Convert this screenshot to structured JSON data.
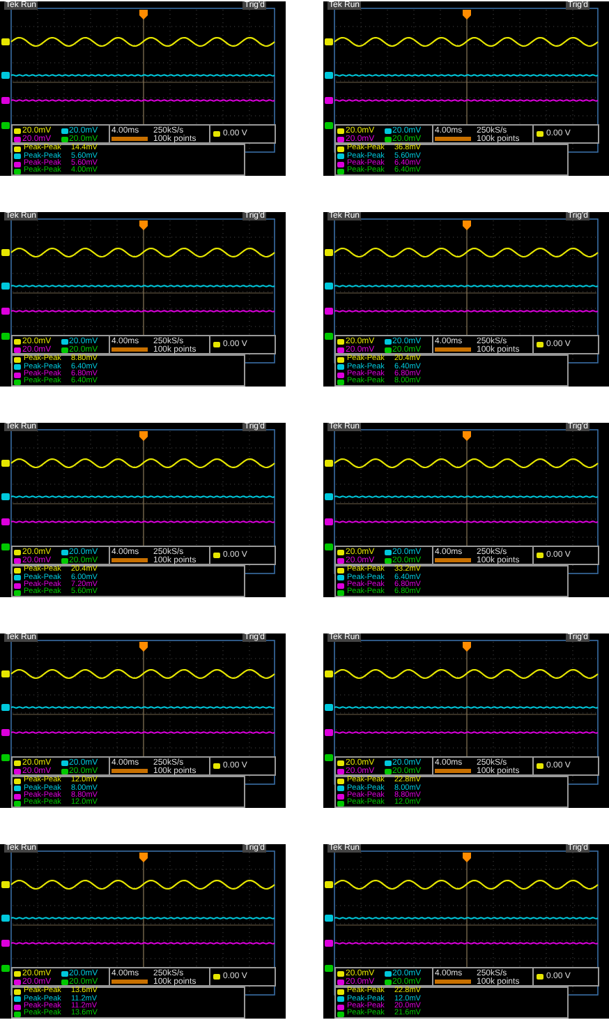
{
  "panels": [
    {
      "status": "Tek Run",
      "trigger_state": "Trig'd",
      "scales": [
        {
          "value": "20.0mV",
          "color": "#e6e600"
        },
        {
          "value": "20.0mV",
          "color": "#00c8dc"
        },
        {
          "value": "20.0mV",
          "color": "#dc00dc"
        },
        {
          "value": "20.0mV",
          "color": "#00c800"
        }
      ],
      "timebase": "4.00ms",
      "sample_rate": "250kS/s",
      "record": "100k points",
      "trigger_level": "0.00 V",
      "measurements": [
        {
          "label": "Peak-Peak",
          "value": "14.4mV"
        },
        {
          "label": "Peak-Peak",
          "value": "5.60mV"
        },
        {
          "label": "Peak-Peak",
          "value": "5.60mV"
        },
        {
          "label": "Peak-Peak",
          "value": "4.00mV"
        }
      ]
    },
    {
      "status": "Tek Run",
      "trigger_state": "Trig'd",
      "scales": [
        {
          "value": "20.0mV",
          "color": "#e6e600"
        },
        {
          "value": "20.0mV",
          "color": "#00c8dc"
        },
        {
          "value": "20.0mV",
          "color": "#dc00dc"
        },
        {
          "value": "20.0mV",
          "color": "#00c800"
        }
      ],
      "timebase": "4.00ms",
      "sample_rate": "250kS/s",
      "record": "100k points",
      "trigger_level": "0.00 V",
      "measurements": [
        {
          "label": "Peak-Peak",
          "value": "36.8mV"
        },
        {
          "label": "Peak-Peak",
          "value": "5.60mV"
        },
        {
          "label": "Peak-Peak",
          "value": "6.40mV"
        },
        {
          "label": "Peak-Peak",
          "value": "6.40mV"
        }
      ]
    },
    {
      "status": "Tek Run",
      "trigger_state": "Trig'd",
      "scales": [
        {
          "value": "20.0mV",
          "color": "#e6e600"
        },
        {
          "value": "20.0mV",
          "color": "#00c8dc"
        },
        {
          "value": "20.0mV",
          "color": "#dc00dc"
        },
        {
          "value": "20.0mV",
          "color": "#00c800"
        }
      ],
      "timebase": "4.00ms",
      "sample_rate": "250kS/s",
      "record": "100k points",
      "trigger_level": "0.00 V",
      "measurements": [
        {
          "label": "Peak-Peak",
          "value": "8.80mV"
        },
        {
          "label": "Peak-Peak",
          "value": "6.40mV"
        },
        {
          "label": "Peak-Peak",
          "value": "6.80mV"
        },
        {
          "label": "Peak-Peak",
          "value": "6.40mV"
        }
      ]
    },
    {
      "status": "Tek Run",
      "trigger_state": "Trig'd",
      "scales": [
        {
          "value": "20.0mV",
          "color": "#e6e600"
        },
        {
          "value": "20.0mV",
          "color": "#00c8dc"
        },
        {
          "value": "20.0mV",
          "color": "#dc00dc"
        },
        {
          "value": "20.0mV",
          "color": "#00c800"
        }
      ],
      "timebase": "4.00ms",
      "sample_rate": "250kS/s",
      "record": "100k points",
      "trigger_level": "0.00 V",
      "measurements": [
        {
          "label": "Peak-Peak",
          "value": "20.4mV"
        },
        {
          "label": "Peak-Peak",
          "value": "6.40mV"
        },
        {
          "label": "Peak-Peak",
          "value": "6.80mV"
        },
        {
          "label": "Peak-Peak",
          "value": "8.00mV"
        }
      ]
    },
    {
      "status": "Tek Run",
      "trigger_state": "Trig'd",
      "scales": [
        {
          "value": "20.0mV",
          "color": "#e6e600"
        },
        {
          "value": "20.0mV",
          "color": "#00c8dc"
        },
        {
          "value": "20.0mV",
          "color": "#dc00dc"
        },
        {
          "value": "20.0mV",
          "color": "#00c800"
        }
      ],
      "timebase": "4.00ms",
      "sample_rate": "250kS/s",
      "record": "100k points",
      "trigger_level": "0.00 V",
      "measurements": [
        {
          "label": "Peak-Peak",
          "value": "20.4mV"
        },
        {
          "label": "Peak-Peak",
          "value": "6.00mV"
        },
        {
          "label": "Peak-Peak",
          "value": "7.20mV"
        },
        {
          "label": "Peak-Peak",
          "value": "5.60mV"
        }
      ]
    },
    {
      "status": "Tek Run",
      "trigger_state": "Trig'd",
      "scales": [
        {
          "value": "20.0mV",
          "color": "#e6e600"
        },
        {
          "value": "20.0mV",
          "color": "#00c8dc"
        },
        {
          "value": "20.0mV",
          "color": "#dc00dc"
        },
        {
          "value": "20.0mV",
          "color": "#00c800"
        }
      ],
      "timebase": "4.00ms",
      "sample_rate": "250kS/s",
      "record": "100k points",
      "trigger_level": "0.00 V",
      "measurements": [
        {
          "label": "Peak-Peak",
          "value": "33.2mV"
        },
        {
          "label": "Peak-Peak",
          "value": "6.40mV"
        },
        {
          "label": "Peak-Peak",
          "value": "6.80mV"
        },
        {
          "label": "Peak-Peak",
          "value": "6.80mV"
        }
      ]
    },
    {
      "status": "Tek Run",
      "trigger_state": "Trig'd",
      "scales": [
        {
          "value": "20.0mV",
          "color": "#e6e600"
        },
        {
          "value": "20.0mV",
          "color": "#00c8dc"
        },
        {
          "value": "20.0mV",
          "color": "#dc00dc"
        },
        {
          "value": "20.0mV",
          "color": "#00c800"
        }
      ],
      "timebase": "4.00ms",
      "sample_rate": "250kS/s",
      "record": "100k points",
      "trigger_level": "0.00 V",
      "measurements": [
        {
          "label": "Peak-Peak",
          "value": "12.0mV"
        },
        {
          "label": "Peak-Peak",
          "value": "8.00mV"
        },
        {
          "label": "Peak-Peak",
          "value": "8.80mV"
        },
        {
          "label": "Peak-Peak",
          "value": "12.0mV"
        }
      ]
    },
    {
      "status": "Tek Run",
      "trigger_state": "Trig'd",
      "scales": [
        {
          "value": "20.0mV",
          "color": "#e6e600"
        },
        {
          "value": "20.0mV",
          "color": "#00c8dc"
        },
        {
          "value": "20.0mV",
          "color": "#dc00dc"
        },
        {
          "value": "20.0mV",
          "color": "#00c800"
        }
      ],
      "timebase": "4.00ms",
      "sample_rate": "250kS/s",
      "record": "100k points",
      "trigger_level": "0.00 V",
      "measurements": [
        {
          "label": "Peak-Peak",
          "value": "22.8mV"
        },
        {
          "label": "Peak-Peak",
          "value": "8.00mV"
        },
        {
          "label": "Peak-Peak",
          "value": "8.80mV"
        },
        {
          "label": "Peak-Peak",
          "value": "12.0mV"
        }
      ]
    },
    {
      "status": "Tek Run",
      "trigger_state": "Trig'd",
      "scales": [
        {
          "value": "20.0mV",
          "color": "#e6e600"
        },
        {
          "value": "20.0mV",
          "color": "#00c8dc"
        },
        {
          "value": "20.0mV",
          "color": "#dc00dc"
        },
        {
          "value": "20.0mV",
          "color": "#00c800"
        }
      ],
      "timebase": "4.00ms",
      "sample_rate": "250kS/s",
      "record": "100k points",
      "trigger_level": "0.00 V",
      "measurements": [
        {
          "label": "Peak-Peak",
          "value": "13.6mV"
        },
        {
          "label": "Peak-Peak",
          "value": "11.2mV"
        },
        {
          "label": "Peak-Peak",
          "value": "11.2mV"
        },
        {
          "label": "Peak-Peak",
          "value": "13.6mV"
        }
      ]
    },
    {
      "status": "Tek Run",
      "trigger_state": "Trig'd",
      "scales": [
        {
          "value": "20.0mV",
          "color": "#e6e600"
        },
        {
          "value": "20.0mV",
          "color": "#00c8dc"
        },
        {
          "value": "20.0mV",
          "color": "#dc00dc"
        },
        {
          "value": "20.0mV",
          "color": "#00c800"
        }
      ],
      "timebase": "4.00ms",
      "sample_rate": "250kS/s",
      "record": "100k points",
      "trigger_level": "0.00 V",
      "measurements": [
        {
          "label": "Peak-Peak",
          "value": "22.8mV"
        },
        {
          "label": "Peak-Peak",
          "value": "12.0mV"
        },
        {
          "label": "Peak-Peak",
          "value": "20.0mV"
        },
        {
          "label": "Peak-Peak",
          "value": "21.6mV"
        }
      ]
    }
  ]
}
